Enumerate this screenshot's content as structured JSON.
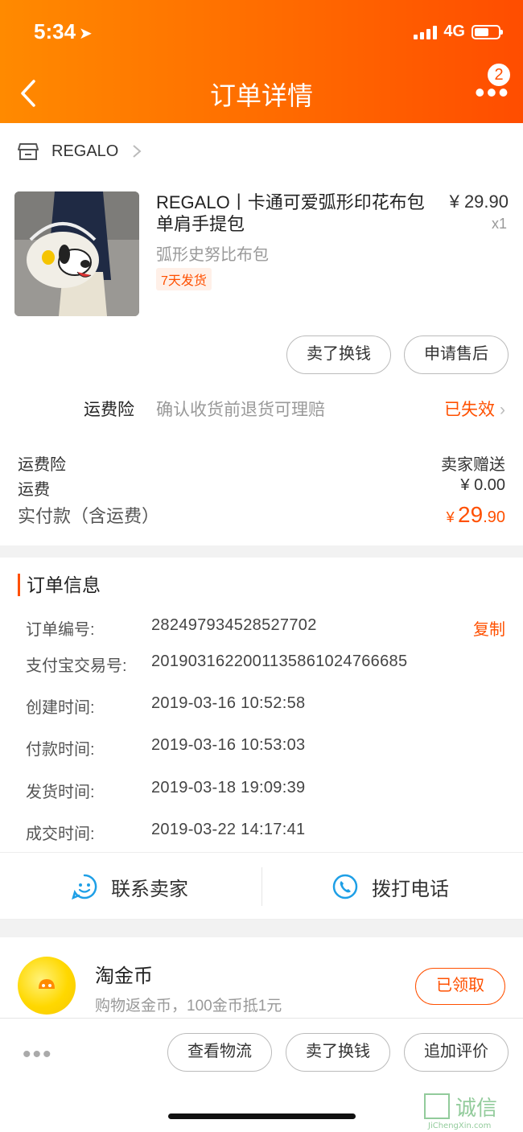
{
  "status_bar": {
    "time": "5:34",
    "network": "4G"
  },
  "header": {
    "title": "订单详情",
    "badge_count": "2"
  },
  "shop": {
    "name": "REGALO"
  },
  "product": {
    "title": "REGALO丨卡通可爱弧形印花布包单肩手提包",
    "price": "¥ 29.90",
    "quantity": "x1",
    "sku": "弧形史努比布包",
    "tag": "7天发货"
  },
  "item_actions": {
    "sell": "卖了换钱",
    "after_sale": "申请售后"
  },
  "insurance": {
    "label": "运费险",
    "description": "确认收货前退货可理赔",
    "status": "已失效"
  },
  "fees": [
    {
      "label": "运费险",
      "value": "卖家赠送"
    },
    {
      "label": "运费",
      "value": "¥ 0.00"
    }
  ],
  "paid": {
    "label": "实付款（含运费）",
    "symbol": "¥",
    "integer": "29",
    "decimal": ".90"
  },
  "order_info": {
    "title": "订单信息",
    "copy": "复制",
    "rows": [
      {
        "label": "订单编号:",
        "value": "282497934528527702"
      },
      {
        "label": "支付宝交易号:",
        "value": "2019031622001135861024766685"
      },
      {
        "label": "创建时间:",
        "value": "2019-03-16 10:52:58"
      },
      {
        "label": "付款时间:",
        "value": "2019-03-16 10:53:03"
      },
      {
        "label": "发货时间:",
        "value": "2019-03-18 19:09:39"
      },
      {
        "label": "成交时间:",
        "value": "2019-03-22 14:17:41"
      }
    ]
  },
  "contact": {
    "seller": "联系卖家",
    "phone": "拨打电话"
  },
  "coin": {
    "title": "淘金币",
    "description": "购物返金币，100金币抵1元",
    "button": "已领取"
  },
  "bottom_actions": {
    "logistics": "查看物流",
    "sell": "卖了换钱",
    "review": "追加评价"
  },
  "watermark": {
    "cn": "集诚信",
    "url": "JiChengXin.com"
  },
  "colors": {
    "accent": "#ff5000",
    "header_start": "#ff8a00",
    "header_end": "#ff4d00",
    "contact_icon": "#1e9fe6"
  }
}
